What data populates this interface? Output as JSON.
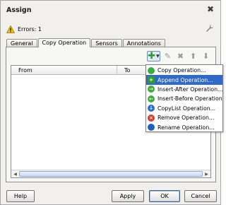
{
  "dialog": {
    "title": "Assign",
    "errors_label": "Errors: 1"
  },
  "tabs": [
    {
      "label": "General",
      "active": false
    },
    {
      "label": "Copy Operation",
      "active": true
    },
    {
      "label": "Sensors",
      "active": false
    },
    {
      "label": "Annotations",
      "active": false
    }
  ],
  "table": {
    "columns": [
      "From",
      "To"
    ]
  },
  "toolbar_icons": [
    "add-icon",
    "edit-icon",
    "delete-icon",
    "move-up-icon",
    "move-down-icon"
  ],
  "menu": {
    "items": [
      {
        "label": "Copy Operation...",
        "icon": "copy-operation-icon",
        "color": "#3cae3c",
        "glyph": "",
        "selected": false
      },
      {
        "label": "Append Operation...",
        "icon": "append-operation-icon",
        "color": "#2f9e2f",
        "glyph": "+",
        "selected": true
      },
      {
        "label": "Insert-After Operation...",
        "icon": "insert-after-icon",
        "color": "#3cae3c",
        "glyph": "→",
        "selected": false
      },
      {
        "label": "Insert-Before Operation...",
        "icon": "insert-before-icon",
        "color": "#3cae3c",
        "glyph": "←",
        "selected": false
      },
      {
        "label": "CopyList Operation...",
        "icon": "copylist-operation-icon",
        "color": "#2a6fcf",
        "glyph": "↓",
        "selected": false
      },
      {
        "label": "Remove Operation...",
        "icon": "remove-operation-icon",
        "color": "#d93a2b",
        "glyph": "×",
        "selected": false
      },
      {
        "label": "Rename Operation...",
        "icon": "rename-operation-icon",
        "color": "#1f5fbf",
        "glyph": "",
        "selected": false
      }
    ]
  },
  "buttons": {
    "help": "Help",
    "apply": "Apply",
    "ok": "OK",
    "cancel": "Cancel"
  },
  "colors": {
    "selection": "#316ac5",
    "dialog_bg": "#f1f0ec",
    "add_green": "#2c9b2c"
  }
}
